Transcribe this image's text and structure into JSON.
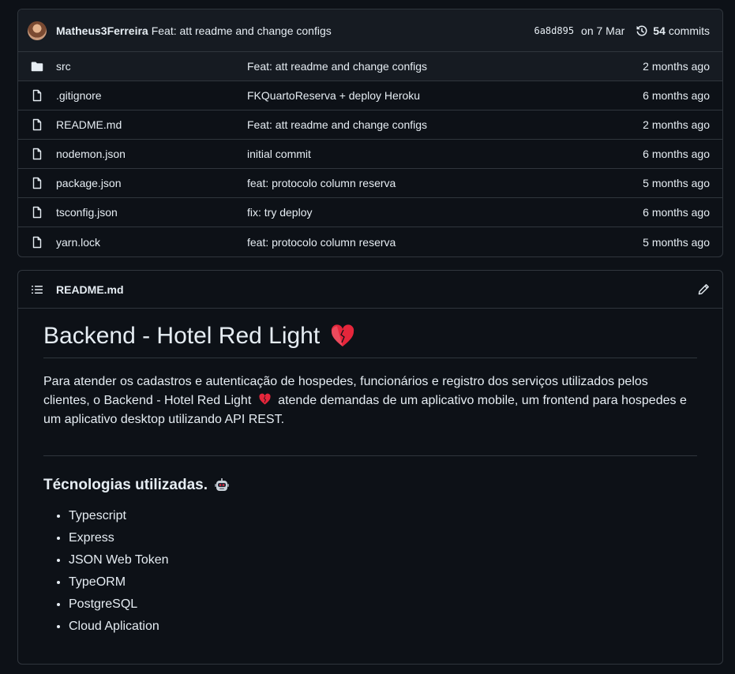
{
  "commit": {
    "author": "Matheus3Ferreira",
    "message": "Feat: att readme and change configs",
    "sha": "6a8d895",
    "date": "on 7 Mar",
    "commits_count": "54",
    "commits_label": "commits"
  },
  "files": [
    {
      "type": "folder",
      "name": "src",
      "commit": "Feat: att readme and change configs",
      "age": "2 months ago"
    },
    {
      "type": "file",
      "name": ".gitignore",
      "commit": "FKQuartoReserva + deploy Heroku",
      "age": "6 months ago"
    },
    {
      "type": "file",
      "name": "README.md",
      "commit": "Feat: att readme and change configs",
      "age": "2 months ago"
    },
    {
      "type": "file",
      "name": "nodemon.json",
      "commit": "initial commit",
      "age": "6 months ago"
    },
    {
      "type": "file",
      "name": "package.json",
      "commit": "feat: protocolo column reserva",
      "age": "5 months ago"
    },
    {
      "type": "file",
      "name": "tsconfig.json",
      "commit": "fix: try deploy",
      "age": "6 months ago"
    },
    {
      "type": "file",
      "name": "yarn.lock",
      "commit": "feat: protocolo column reserva",
      "age": "5 months ago"
    }
  ],
  "readme": {
    "filename": "README.md",
    "title": "Backend - Hotel Red Light",
    "desc_part1": "Para atender os cadastros e autenticação de hospedes, funcionários e registro dos serviços utilizados pelos clientes, o Backend - Hotel Red Light",
    "desc_part2": "atende demandas de um aplicativo mobile, um frontend para hospedes e um aplicativo desktop utilizando API REST.",
    "tech_heading": "Técnologias utilizadas.",
    "technologies": [
      "Typescript",
      "Express",
      "JSON Web Token",
      "TypeORM",
      "PostgreSQL",
      "Cloud Aplication"
    ]
  },
  "colors": {
    "background": "#0d1117",
    "header": "#161b22",
    "border": "#30363d",
    "text": "#e6edf3",
    "heart": "#e5263b"
  }
}
